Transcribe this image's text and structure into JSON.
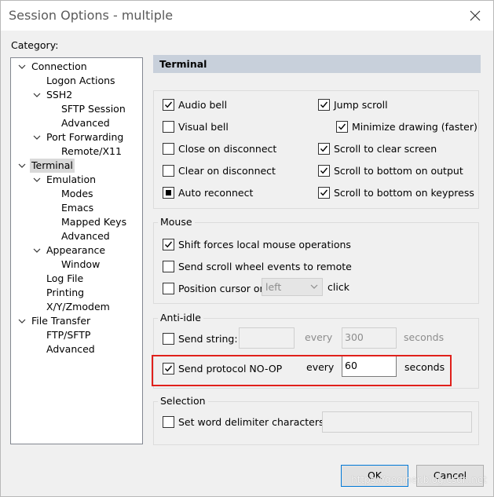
{
  "window": {
    "title": "Session Options - multiple"
  },
  "category_label": "Category:",
  "tree": [
    {
      "label": "Connection",
      "indent": 0,
      "expanded": true
    },
    {
      "label": "Logon Actions",
      "indent": 1
    },
    {
      "label": "SSH2",
      "indent": 1,
      "expanded": true
    },
    {
      "label": "SFTP Session",
      "indent": 2
    },
    {
      "label": "Advanced",
      "indent": 2
    },
    {
      "label": "Port Forwarding",
      "indent": 1,
      "expanded": true
    },
    {
      "label": "Remote/X11",
      "indent": 2
    },
    {
      "label": "Terminal",
      "indent": 0,
      "expanded": true,
      "selected": true
    },
    {
      "label": "Emulation",
      "indent": 1,
      "expanded": true
    },
    {
      "label": "Modes",
      "indent": 2
    },
    {
      "label": "Emacs",
      "indent": 2
    },
    {
      "label": "Mapped Keys",
      "indent": 2
    },
    {
      "label": "Advanced",
      "indent": 2
    },
    {
      "label": "Appearance",
      "indent": 1,
      "expanded": true
    },
    {
      "label": "Window",
      "indent": 2
    },
    {
      "label": "Log File",
      "indent": 1
    },
    {
      "label": "Printing",
      "indent": 1
    },
    {
      "label": "X/Y/Zmodem",
      "indent": 1
    },
    {
      "label": "File Transfer",
      "indent": 0,
      "expanded": true
    },
    {
      "label": "FTP/SFTP",
      "indent": 1
    },
    {
      "label": "Advanced",
      "indent": 1
    }
  ],
  "header": "Terminal",
  "terminal": {
    "audio_bell": "Audio bell",
    "visual_bell": "Visual bell",
    "close_on_disconnect": "Close on disconnect",
    "clear_on_disconnect": "Clear on disconnect",
    "auto_reconnect": "Auto reconnect",
    "jump_scroll": "Jump scroll",
    "minimize_drawing": "Minimize drawing (faster)",
    "scroll_clear": "Scroll to clear screen",
    "scroll_bottom_output": "Scroll to bottom on output",
    "scroll_bottom_keypress": "Scroll to bottom on keypress"
  },
  "mouse": {
    "title": "Mouse",
    "shift_forces": "Shift forces local mouse operations",
    "send_scroll": "Send scroll wheel events to remote",
    "position_cursor": "Position cursor on",
    "position_value": "left",
    "click": "click"
  },
  "anti_idle": {
    "title": "Anti-idle",
    "send_string": "Send string:",
    "every1": "every",
    "value1": "300",
    "seconds1": "seconds",
    "send_noop": "Send protocol NO-OP",
    "every2": "every",
    "value2": "60",
    "seconds2": "seconds"
  },
  "selection": {
    "title": "Selection",
    "delimiter": "Set word delimiter characters:"
  },
  "buttons": {
    "ok": "OK",
    "cancel": "Cancel"
  },
  "watermark": "https://geqiner.blog.csdn.net",
  "colors": {
    "highlight": "#e0201b",
    "header_bg": "#c8d0db",
    "default_button_border": "#0078d7"
  }
}
